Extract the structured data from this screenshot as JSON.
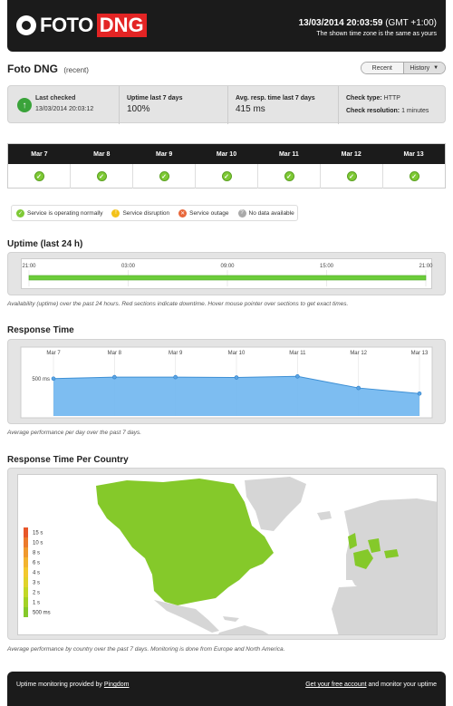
{
  "header": {
    "logo_text": "FOTO",
    "logo_badge": "DNG",
    "datetime": "13/03/2014 20:03:59",
    "tz": "(GMT +1:00)",
    "tz_note": "The shown time zone is the same as yours"
  },
  "page": {
    "title": "Foto DNG",
    "subtitle": "(recent)",
    "tabs": [
      "Recent",
      "History"
    ]
  },
  "summary": {
    "last_checked_label": "Last checked",
    "last_checked_value": "13/03/2014 20:03:12",
    "uptime_label": "Uptime last 7 days",
    "uptime_value": "100%",
    "resp_label": "Avg. resp. time last 7 days",
    "resp_value": "415 ms",
    "check_type_label": "Check type:",
    "check_type_value": "HTTP",
    "check_res_label": "Check resolution:",
    "check_res_value": "1 minutes"
  },
  "days": [
    "Mar 7",
    "Mar 8",
    "Mar 9",
    "Mar 10",
    "Mar 11",
    "Mar 12",
    "Mar 13"
  ],
  "day_status": [
    "ok",
    "ok",
    "ok",
    "ok",
    "ok",
    "ok",
    "ok"
  ],
  "legend": [
    {
      "label": "Service is operating normally",
      "color": "#7ec935",
      "glyph": "✓"
    },
    {
      "label": "Service disruption",
      "color": "#f3c21a",
      "glyph": "!"
    },
    {
      "label": "Service outage",
      "color": "#e8673a",
      "glyph": "✕"
    },
    {
      "label": "No data available",
      "color": "#aaaaaa",
      "glyph": "?"
    }
  ],
  "uptime": {
    "heading": "Uptime (last 24 h)",
    "ticks": [
      "21:00",
      "03:00",
      "09:00",
      "15:00",
      "21:00"
    ],
    "caption": "Availability (uptime) over the past 24 hours. Red sections indicate downtime. Hover mouse pointer over sections to get exact times."
  },
  "response": {
    "heading": "Response Time",
    "caption": "Average performance per day over the past 7 days."
  },
  "chart_data": {
    "type": "area",
    "title": "Response Time",
    "categories": [
      "Mar 7",
      "Mar 8",
      "Mar 9",
      "Mar 10",
      "Mar 11",
      "Mar 12",
      "Mar 13"
    ],
    "values": [
      500,
      520,
      520,
      515,
      530,
      375,
      300
    ],
    "ytick_label": "500 ms",
    "ylim": [
      0,
      800
    ],
    "grid": true,
    "color": "#6fb6ef"
  },
  "country": {
    "heading": "Response Time Per Country",
    "scale": [
      "15 s",
      "10 s",
      "8 s",
      "6 s",
      "4 s",
      "3 s",
      "2 s",
      "1 s",
      "500 ms"
    ],
    "scale_colors": [
      "#e8572a",
      "#ec7a2c",
      "#f0992e",
      "#f3b430",
      "#f3c92e",
      "#e0d32a",
      "#c2d826",
      "#a3d225",
      "#85c92a"
    ],
    "caption": "Average performance by country over the past 7 days. Monitoring is done from Europe and North America."
  },
  "footer": {
    "left_text": "Uptime monitoring provided by",
    "left_link": "Pingdom",
    "right_link": "Get your free account",
    "right_text": "and monitor your uptime"
  }
}
